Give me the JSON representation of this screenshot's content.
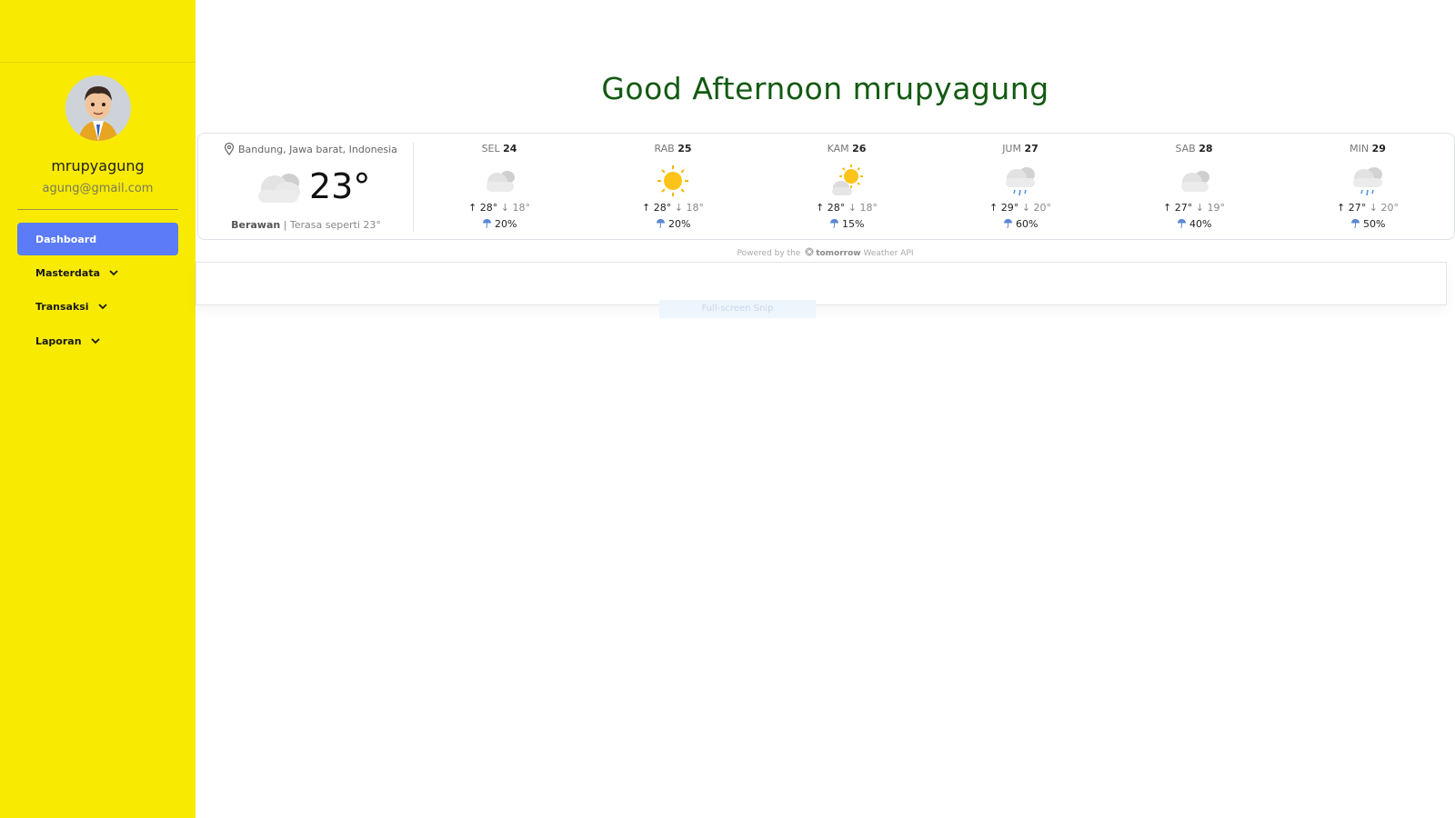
{
  "user": {
    "name": "mrupyagung",
    "email": "agung@gmail.com"
  },
  "nav": {
    "dashboard": "Dashboard",
    "masterdata": "Masterdata",
    "transaksi": "Transaksi",
    "laporan": "Laporan"
  },
  "greeting": "Good Afternoon mrupyagung",
  "current": {
    "location": "Bandung, Jawa barat, Indonesia",
    "temp": "23°",
    "condition": "Berawan",
    "separator": " | ",
    "feels_like": "Terasa seperti 23°",
    "icon": "cloud-icon"
  },
  "forecast": [
    {
      "dow": "SEL",
      "date": "24",
      "hi": "28°",
      "lo": "18°",
      "rain": "20%",
      "icon": "cloud-icon"
    },
    {
      "dow": "RAB",
      "date": "25",
      "hi": "28°",
      "lo": "18°",
      "rain": "20%",
      "icon": "sun-icon"
    },
    {
      "dow": "KAM",
      "date": "26",
      "hi": "28°",
      "lo": "18°",
      "rain": "15%",
      "icon": "partly-cloudy-icon"
    },
    {
      "dow": "JUM",
      "date": "27",
      "hi": "29°",
      "lo": "20°",
      "rain": "60%",
      "icon": "rain-icon"
    },
    {
      "dow": "SAB",
      "date": "28",
      "hi": "27°",
      "lo": "19°",
      "rain": "40%",
      "icon": "cloud-icon"
    },
    {
      "dow": "MIN",
      "date": "29",
      "hi": "27°",
      "lo": "20°",
      "rain": "50%",
      "icon": "rain-icon"
    }
  ],
  "powered": {
    "prefix": "Powered by the",
    "brand": "tomorrow",
    "suffix": "Weather API"
  },
  "snip_label": "Full-screen Snip",
  "colors": {
    "sidebar": "#f8ea00",
    "active_nav": "#5b7cf6",
    "greeting": "#135a12"
  }
}
